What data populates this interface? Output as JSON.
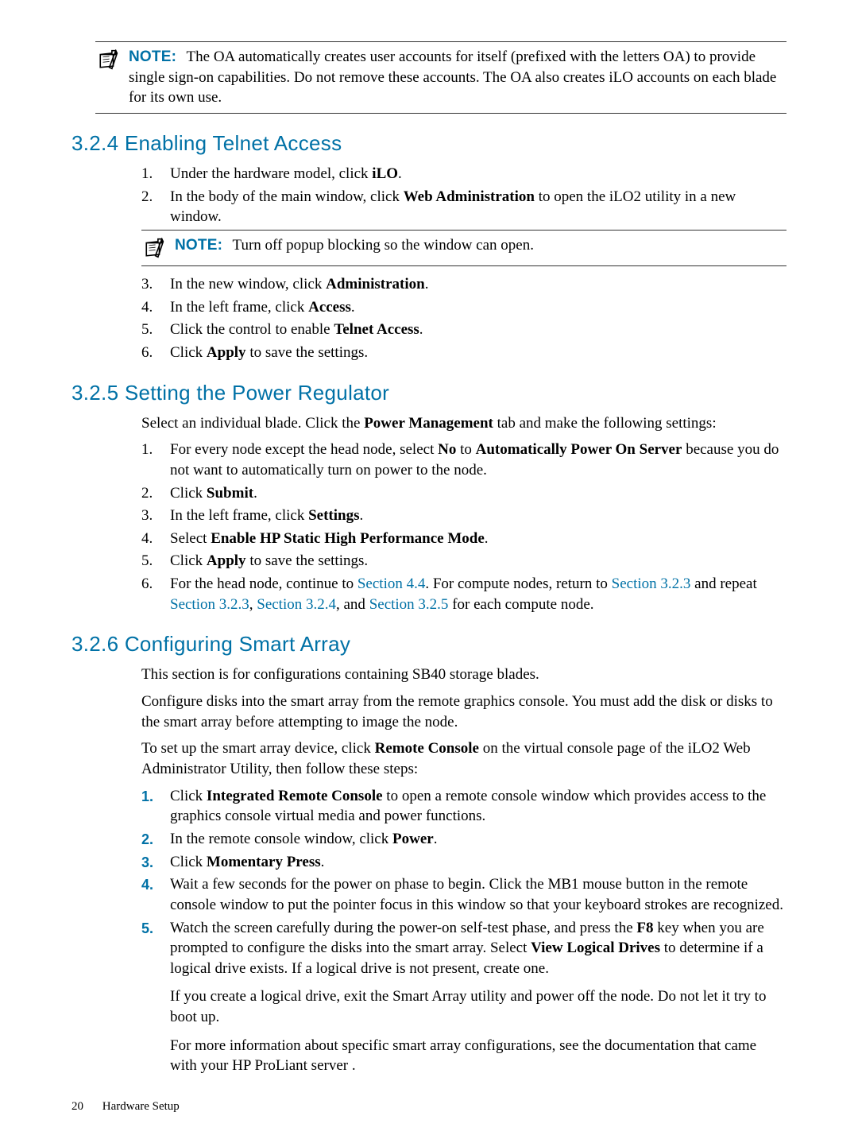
{
  "notes": {
    "label": "NOTE:",
    "n1": "The OA automatically creates user accounts for itself (prefixed with the letters OA) to provide single sign-on capabilities. Do not remove these accounts. The OA also creates iLO accounts on each blade for its own use.",
    "n2": "Turn off popup blocking so the window can open."
  },
  "s324": {
    "heading": "3.2.4 Enabling Telnet Access",
    "items": [
      {
        "n": "1.",
        "pre": "Under the hardware model, click ",
        "b1": "iLO",
        "post": "."
      },
      {
        "n": "2.",
        "pre": "In the body of the main window, click ",
        "b1": "Web Administration",
        "post": " to open the iLO2 utility in a new window."
      },
      {
        "n": "3.",
        "pre": "In the new window, click ",
        "b1": "Administration",
        "post": "."
      },
      {
        "n": "4.",
        "pre": "In the left frame, click ",
        "b1": "Access",
        "post": "."
      },
      {
        "n": "5.",
        "pre": "Click the control to enable ",
        "b1": "Telnet Access",
        "post": "."
      },
      {
        "n": "6.",
        "pre": "Click ",
        "b1": "Apply",
        "post": " to save the settings."
      }
    ]
  },
  "s325": {
    "heading": "3.2.5 Setting the Power Regulator",
    "intro_pre": "Select an individual blade. Click the ",
    "intro_b": "Power Management",
    "intro_post": " tab and make the following settings:",
    "items": [
      {
        "n": "1.",
        "pre": "For every node except the head node, select ",
        "b1": "No",
        "mid": " to ",
        "b2": "Automatically Power On Server",
        "post": " because you do not want to automatically turn on power to the node."
      },
      {
        "n": "2.",
        "pre": "Click ",
        "b1": "Submit",
        "post": "."
      },
      {
        "n": "3.",
        "pre": "In the left frame, click ",
        "b1": "Settings",
        "post": "."
      },
      {
        "n": "4.",
        "pre": "Select ",
        "b1": "Enable HP Static High Performance Mode",
        "post": "."
      },
      {
        "n": "5.",
        "pre": "Click ",
        "b1": "Apply",
        "post": " to save the settings."
      },
      {
        "n": "6.",
        "pre": "For the head node, continue to ",
        "l1": "Section 4.4",
        "mid1": ". For compute nodes, return to ",
        "l2": "Section 3.2.3",
        "mid2": " and repeat ",
        "l3": "Section 3.2.3",
        "mid3": ", ",
        "l4": "Section 3.2.4",
        "mid4": ", and ",
        "l5": "Section 3.2.5",
        "post": " for each compute node."
      }
    ]
  },
  "s326": {
    "heading": "3.2.6 Configuring Smart Array",
    "p1": "This section is for configurations containing SB40 storage blades.",
    "p2": "Configure disks into the smart array from the remote graphics console. You must add the disk or disks to the smart array before attempting to image the node.",
    "p3_pre": "To set up the smart array device, click ",
    "p3_b": "Remote Console",
    "p3_post": " on the virtual console page of the iLO2 Web Administrator Utility, then follow these steps:",
    "items": [
      {
        "n": "1.",
        "pre": "Click ",
        "b1": "Integrated Remote Console",
        "post": " to open a remote console window which provides access to the graphics console virtual media and power functions."
      },
      {
        "n": "2.",
        "pre": "In the remote console window, click ",
        "b1": "Power",
        "post": "."
      },
      {
        "n": "3.",
        "pre": "Click ",
        "b1": "Momentary Press",
        "post": "."
      },
      {
        "n": "4.",
        "pre": "Wait a few seconds for the power on phase to begin. Click the MB1 mouse button in the remote console window to put the pointer focus in this window so that your keyboard strokes are recognized."
      },
      {
        "n": "5.",
        "pre": "Watch the screen carefully during the power-on self-test phase, and press the ",
        "b1": "F8",
        "mid": " key when you are prompted to configure the disks into the smart array. Select ",
        "b2": "View Logical Drives",
        "post": " to determine if a logical drive exists. If a logical drive is not present, create one.",
        "sub1": "If you create a logical drive, exit the Smart Array utility and power off the node. Do not let it try to boot up.",
        "sub2": "For more information about specific smart array configurations, see the documentation that came with your HP ProLiant server ."
      }
    ]
  },
  "footer": {
    "page": "20",
    "title": "Hardware Setup"
  }
}
